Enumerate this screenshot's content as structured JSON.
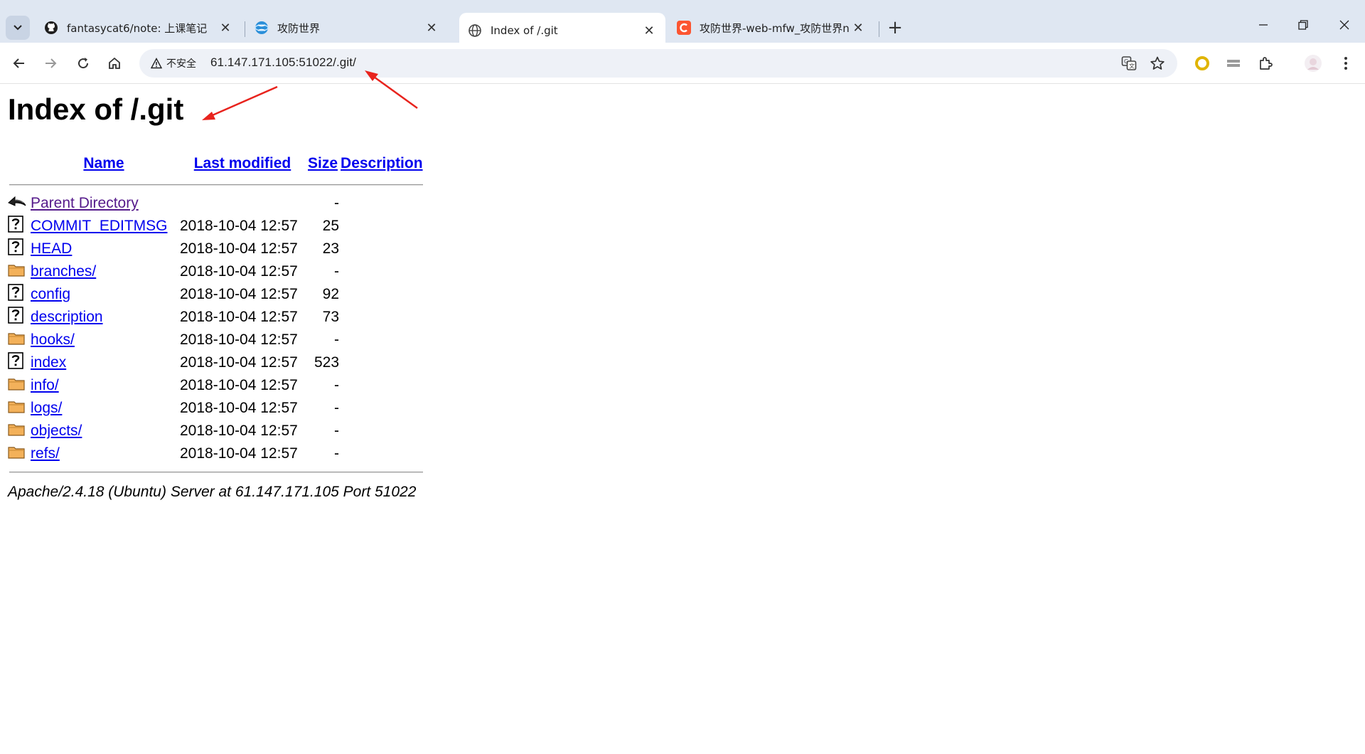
{
  "browser": {
    "tabs": [
      {
        "title": "fantasycat6/note: 上课笔记",
        "icon": "github-icon",
        "active": false
      },
      {
        "title": "攻防世界",
        "icon": "xctf-globe-icon",
        "active": false
      },
      {
        "title": "Index of /.git",
        "icon": "globe-icon",
        "active": true
      },
      {
        "title": "攻防世界-web-mfw_攻防世界n",
        "icon": "csdn-icon",
        "active": false
      }
    ],
    "security_chip": "不安全",
    "url": "61.147.171.105:51022/.git/"
  },
  "page": {
    "heading": "Index of /.git",
    "columns": {
      "name": "Name",
      "last_modified": "Last modified",
      "size": "Size",
      "description": "Description"
    },
    "parent": {
      "name": "Parent Directory",
      "size": "-"
    },
    "rows": [
      {
        "name": "COMMIT_EDITMSG",
        "modified": "2018-10-04 12:57",
        "size": "25",
        "type": "file"
      },
      {
        "name": "HEAD",
        "modified": "2018-10-04 12:57",
        "size": "23",
        "type": "file"
      },
      {
        "name": "branches/",
        "modified": "2018-10-04 12:57",
        "size": "-",
        "type": "folder"
      },
      {
        "name": "config",
        "modified": "2018-10-04 12:57",
        "size": "92",
        "type": "file"
      },
      {
        "name": "description",
        "modified": "2018-10-04 12:57",
        "size": "73",
        "type": "file"
      },
      {
        "name": "hooks/",
        "modified": "2018-10-04 12:57",
        "size": "-",
        "type": "folder"
      },
      {
        "name": "index",
        "modified": "2018-10-04 12:57",
        "size": "523",
        "type": "file"
      },
      {
        "name": "info/",
        "modified": "2018-10-04 12:57",
        "size": "-",
        "type": "folder"
      },
      {
        "name": "logs/",
        "modified": "2018-10-04 12:57",
        "size": "-",
        "type": "folder"
      },
      {
        "name": "objects/",
        "modified": "2018-10-04 12:57",
        "size": "-",
        "type": "folder"
      },
      {
        "name": "refs/",
        "modified": "2018-10-04 12:57",
        "size": "-",
        "type": "folder"
      }
    ],
    "server_signature": "Apache/2.4.18 (Ubuntu) Server at 61.147.171.105 Port 51022"
  },
  "colors": {
    "link": "#0000ee",
    "visited": "#551a8b",
    "tabbar": "#dfe7f2",
    "annotation": "#e8231d"
  }
}
